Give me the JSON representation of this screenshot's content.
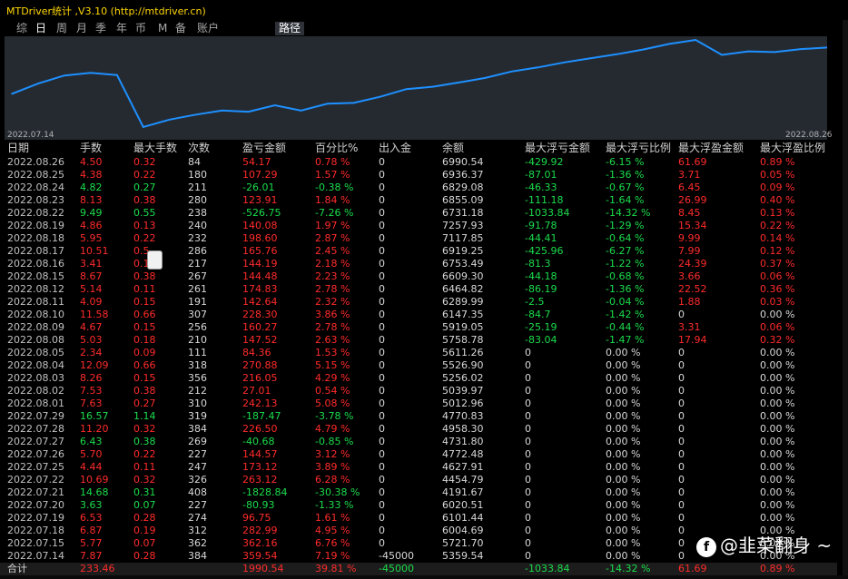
{
  "app": {
    "title": "MTDriver统计 ,V3.10 (http://mtdriver.cn)"
  },
  "tabs": [
    {
      "label": "综"
    },
    {
      "label": "日"
    },
    {
      "label": "周"
    },
    {
      "label": "月"
    },
    {
      "label": "季"
    },
    {
      "label": "年"
    },
    {
      "label": "币"
    },
    {
      "label": "M"
    },
    {
      "label": "备"
    },
    {
      "label": "账户"
    },
    {
      "label": "路径"
    }
  ],
  "active_tab": "日",
  "chart_data": {
    "type": "line",
    "x_start_label": "2022.07.14",
    "x_end_label": "2022.08.26",
    "x": [
      "2022.07.14",
      "2022.07.15",
      "2022.07.18",
      "2022.07.19",
      "2022.07.20",
      "2022.07.21",
      "2022.07.22",
      "2022.07.25",
      "2022.07.26",
      "2022.07.27",
      "2022.07.28",
      "2022.07.29",
      "2022.08.01",
      "2022.08.02",
      "2022.08.03",
      "2022.08.04",
      "2022.08.05",
      "2022.08.08",
      "2022.08.09",
      "2022.08.10",
      "2022.08.11",
      "2022.08.12",
      "2022.08.15",
      "2022.08.16",
      "2022.08.17",
      "2022.08.18",
      "2022.08.19",
      "2022.08.22",
      "2022.08.23",
      "2022.08.24",
      "2022.08.25",
      "2022.08.26"
    ],
    "y": [
      5359.54,
      5721.7,
      6004.69,
      6101.44,
      6020.51,
      4191.67,
      4454.79,
      4627.91,
      4772.48,
      4731.8,
      4958.3,
      4770.83,
      5012.96,
      5039.97,
      5256.02,
      5526.9,
      5611.26,
      5758.78,
      5919.05,
      6147.35,
      6289.99,
      6464.82,
      6609.3,
      6753.49,
      6919.25,
      7117.85,
      7257.93,
      6731.18,
      6855.09,
      6829.08,
      6936.37,
      6990.54
    ],
    "color": "#1e90ff"
  },
  "table": {
    "headers": [
      "日期",
      "手数",
      "最大手数",
      "次数",
      "盈亏金额",
      "百分比%",
      "出入金",
      "余额",
      "最大浮亏金额",
      "最大浮亏比例",
      "最大浮盈金额",
      "最大浮盈比例"
    ],
    "rows": [
      [
        "2022.08.26",
        "4.50",
        "0.32",
        "84",
        "54.17",
        "0.78 %",
        "0",
        "6990.54",
        "-429.92",
        "-6.15 %",
        "61.69",
        "0.89 %"
      ],
      [
        "2022.08.25",
        "4.38",
        "0.22",
        "180",
        "107.29",
        "1.57 %",
        "0",
        "6936.37",
        "-87.01",
        "-1.36 %",
        "3.71",
        "0.05 %"
      ],
      [
        "2022.08.24",
        "4.82",
        "0.27",
        "211",
        "-26.01",
        "-0.38 %",
        "0",
        "6829.08",
        "-46.33",
        "-0.67 %",
        "6.45",
        "0.09 %"
      ],
      [
        "2022.08.23",
        "8.13",
        "0.38",
        "280",
        "123.91",
        "1.84 %",
        "0",
        "6855.09",
        "-111.18",
        "-1.64 %",
        "26.99",
        "0.40 %"
      ],
      [
        "2022.08.22",
        "9.49",
        "0.55",
        "238",
        "-526.75",
        "-7.26 %",
        "0",
        "6731.18",
        "-1033.84",
        "-14.32 %",
        "8.45",
        "0.13 %"
      ],
      [
        "2022.08.19",
        "4.86",
        "0.13",
        "240",
        "140.08",
        "1.97 %",
        "0",
        "7257.93",
        "-91.78",
        "-1.29 %",
        "15.34",
        "0.22 %"
      ],
      [
        "2022.08.18",
        "5.95",
        "0.22",
        "232",
        "198.60",
        "2.87 %",
        "0",
        "7117.85",
        "-44.41",
        "-0.64 %",
        "9.99",
        "0.14 %"
      ],
      [
        "2022.08.17",
        "10.51",
        "0.5",
        "286",
        "165.76",
        "2.45 %",
        "0",
        "6919.25",
        "-425.96",
        "-6.27 %",
        "7.99",
        "0.12 %"
      ],
      [
        "2022.08.16",
        "3.41",
        "0.1",
        "217",
        "144.19",
        "2.18 %",
        "0",
        "6753.49",
        "-81.3",
        "-1.22 %",
        "24.39",
        "0.37 %"
      ],
      [
        "2022.08.15",
        "8.67",
        "0.38",
        "267",
        "144.48",
        "2.23 %",
        "0",
        "6609.30",
        "-44.18",
        "-0.68 %",
        "3.66",
        "0.06 %"
      ],
      [
        "2022.08.12",
        "5.14",
        "0.11",
        "261",
        "174.83",
        "2.78 %",
        "0",
        "6464.82",
        "-86.19",
        "-1.36 %",
        "22.52",
        "0.36 %"
      ],
      [
        "2022.08.11",
        "4.09",
        "0.15",
        "191",
        "142.64",
        "2.32 %",
        "0",
        "6289.99",
        "-2.5",
        "-0.04 %",
        "1.88",
        "0.03 %"
      ],
      [
        "2022.08.10",
        "11.58",
        "0.66",
        "307",
        "228.30",
        "3.86 %",
        "0",
        "6147.35",
        "-84.7",
        "-1.42 %",
        "0",
        "0.00 %"
      ],
      [
        "2022.08.09",
        "4.67",
        "0.15",
        "256",
        "160.27",
        "2.78 %",
        "0",
        "5919.05",
        "-25.19",
        "-0.44 %",
        "3.31",
        "0.06 %"
      ],
      [
        "2022.08.08",
        "5.03",
        "0.18",
        "210",
        "147.52",
        "2.63 %",
        "0",
        "5758.78",
        "-83.04",
        "-1.47 %",
        "17.94",
        "0.32 %"
      ],
      [
        "2022.08.05",
        "2.34",
        "0.09",
        "111",
        "84.36",
        "1.53 %",
        "0",
        "5611.26",
        "0",
        "0.00 %",
        "0",
        "0.00 %"
      ],
      [
        "2022.08.04",
        "12.09",
        "0.66",
        "318",
        "270.88",
        "5.15 %",
        "0",
        "5526.90",
        "0",
        "0.00 %",
        "0",
        "0.00 %"
      ],
      [
        "2022.08.03",
        "8.26",
        "0.15",
        "356",
        "216.05",
        "4.29 %",
        "0",
        "5256.02",
        "0",
        "0.00 %",
        "0",
        "0.00 %"
      ],
      [
        "2022.08.02",
        "7.53",
        "0.38",
        "212",
        "27.01",
        "0.54 %",
        "0",
        "5039.97",
        "0",
        "0.00 %",
        "0",
        "0.00 %"
      ],
      [
        "2022.08.01",
        "7.63",
        "0.27",
        "310",
        "242.13",
        "5.08 %",
        "0",
        "5012.96",
        "0",
        "0.00 %",
        "0",
        "0.00 %"
      ],
      [
        "2022.07.29",
        "16.57",
        "1.14",
        "319",
        "-187.47",
        "-3.78 %",
        "0",
        "4770.83",
        "0",
        "0.00 %",
        "0",
        "0.00 %"
      ],
      [
        "2022.07.28",
        "11.20",
        "0.32",
        "384",
        "226.50",
        "4.79 %",
        "0",
        "4958.30",
        "0",
        "0.00 %",
        "0",
        "0.00 %"
      ],
      [
        "2022.07.27",
        "6.43",
        "0.38",
        "269",
        "-40.68",
        "-0.85 %",
        "0",
        "4731.80",
        "0",
        "0.00 %",
        "0",
        "0.00 %"
      ],
      [
        "2022.07.26",
        "5.70",
        "0.22",
        "227",
        "144.57",
        "3.12 %",
        "0",
        "4772.48",
        "0",
        "0.00 %",
        "0",
        "0.00 %"
      ],
      [
        "2022.07.25",
        "4.44",
        "0.11",
        "247",
        "173.12",
        "3.89 %",
        "0",
        "4627.91",
        "0",
        "0.00 %",
        "0",
        "0.00 %"
      ],
      [
        "2022.07.22",
        "10.69",
        "0.32",
        "326",
        "263.12",
        "6.28 %",
        "0",
        "4454.79",
        "0",
        "0.00 %",
        "0",
        "0.00 %"
      ],
      [
        "2022.07.21",
        "14.68",
        "0.31",
        "408",
        "-1828.84",
        "-30.38 %",
        "0",
        "4191.67",
        "0",
        "0.00 %",
        "0",
        "0.00 %"
      ],
      [
        "2022.07.20",
        "3.63",
        "0.07",
        "227",
        "-80.93",
        "-1.33 %",
        "0",
        "6020.51",
        "0",
        "0.00 %",
        "0",
        "0.00 %"
      ],
      [
        "2022.07.19",
        "6.53",
        "0.28",
        "274",
        "96.75",
        "1.61 %",
        "0",
        "6101.44",
        "0",
        "0.00 %",
        "0",
        "0.00 %"
      ],
      [
        "2022.07.18",
        "6.87",
        "0.19",
        "312",
        "282.99",
        "4.95 %",
        "0",
        "6004.69",
        "0",
        "0.00 %",
        "0",
        "0.00 %"
      ],
      [
        "2022.07.15",
        "5.77",
        "0.07",
        "362",
        "362.16",
        "6.76 %",
        "0",
        "5721.70",
        "0",
        "0.00 %",
        "0",
        "0.00 %"
      ],
      [
        "2022.07.14",
        "7.87",
        "0.28",
        "384",
        "359.54",
        "7.19 %",
        "-45000",
        "5359.54",
        "0",
        "0.00 %",
        "0",
        "0.00 %"
      ]
    ],
    "total": [
      "合计",
      "233.46",
      "",
      "",
      "1990.54",
      "39.81 %",
      "-45000",
      "",
      "-1033.84",
      "-14.32 %",
      "61.69",
      "0.89 %"
    ]
  },
  "watermark": {
    "icon": "f",
    "text": "@韭菜翻身 ~"
  }
}
